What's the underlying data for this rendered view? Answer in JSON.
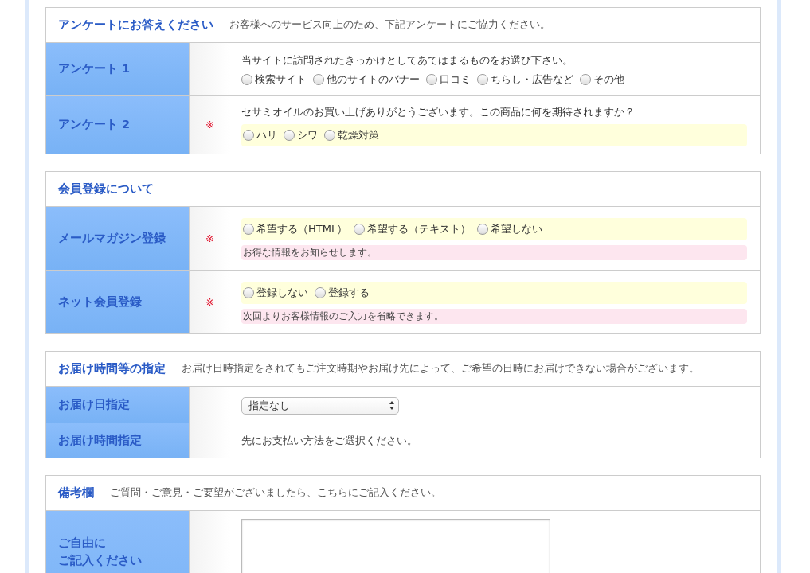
{
  "sections": [
    {
      "title": "アンケートにお答えください",
      "note": "お客様へのサービス向上のため、下記アンケートにご協力ください。",
      "rows": [
        {
          "kind": "radio",
          "label": "アンケート 1",
          "question": "当サイトに訪問されたきっかけとしてあてはまるものをお選び下さい。",
          "options": [
            {
              "label": "検索サイト",
              "selected": false
            },
            {
              "label": "他のサイトのバナー",
              "selected": false
            },
            {
              "label": "口コミ",
              "selected": false
            },
            {
              "label": "ちらし・広告など",
              "selected": false
            },
            {
              "label": "その他",
              "selected": false
            }
          ]
        },
        {
          "kind": "radio",
          "label": "アンケート 2",
          "required_mark": "※",
          "question": "セサミオイルのお買い上げありがとうございます。この商品に何を期待されますか？",
          "options": [
            {
              "label": "ハリ",
              "selected": false
            },
            {
              "label": "シワ",
              "selected": false
            },
            {
              "label": "乾燥対策",
              "selected": false
            }
          ]
        }
      ]
    },
    {
      "title": "会員登録について",
      "rows": [
        {
          "kind": "radio",
          "label": "メールマガジン登録",
          "required_mark": "※",
          "options": [
            {
              "label": "希望する（HTML）",
              "selected": false
            },
            {
              "label": "希望する（テキスト）",
              "selected": false
            },
            {
              "label": "希望しない",
              "selected": false
            }
          ],
          "hint": "お得な情報をお知らせします。"
        },
        {
          "kind": "radio",
          "label": "ネット会員登録",
          "required_mark": "※",
          "options": [
            {
              "label": "登録しない",
              "selected": false
            },
            {
              "label": "登録する",
              "selected": false
            }
          ],
          "hint": "次回よりお客様情報のご入力を省略できます。"
        }
      ]
    },
    {
      "title": "お届け時間等の指定",
      "note": "お届け日時指定をされてもご注文時期やお届け先によって、ご希望の日時にお届けできない場合がございます。",
      "rows": [
        {
          "kind": "select",
          "label": "お届け日指定",
          "value": "指定なし"
        },
        {
          "kind": "text",
          "label": "お届け時間指定",
          "text": "先にお支払い方法をご選択ください。"
        }
      ]
    },
    {
      "title": "備考欄",
      "note": "ご質問・ご意見・ご要望がございましたら、こちらにご記入ください。",
      "rows": [
        {
          "kind": "textarea",
          "label_lines": [
            "ご自由に",
            "ご記入ください"
          ]
        }
      ]
    }
  ]
}
